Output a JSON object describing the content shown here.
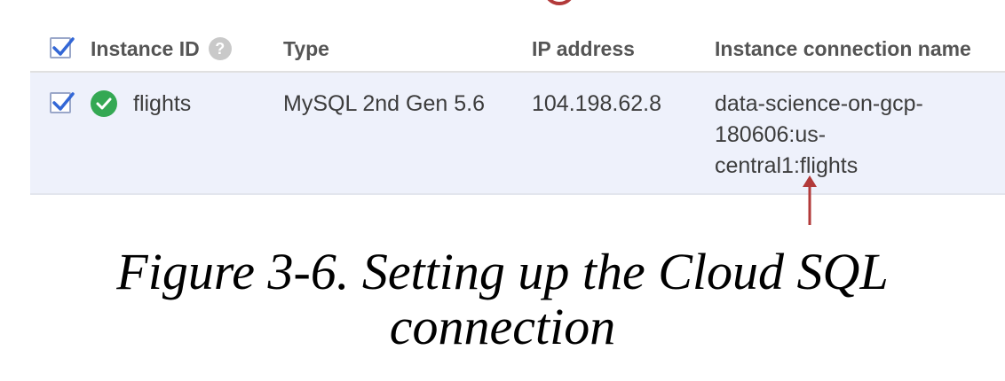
{
  "table": {
    "headers": {
      "instance_id": "Instance ID",
      "type": "Type",
      "ip_address": "IP address",
      "connection_name": "Instance connection name"
    },
    "rows": [
      {
        "selected": true,
        "status": "running",
        "instance_id": "flights",
        "type": "MySQL 2nd Gen 5.6",
        "ip_address": "104.198.62.8",
        "connection_name_lines": [
          "data-science-on-gcp-",
          "180606:us-",
          "central1:flights"
        ]
      }
    ]
  },
  "icons": {
    "header_help": "help-icon",
    "row_status": "check-circle-icon",
    "annotation": "arrow-up-icon"
  },
  "colors": {
    "checkbox_accent": "#3367d6",
    "status_ok": "#34a853",
    "annotation": "#b23a3a",
    "selected_row_bg": "#eef1fb"
  },
  "caption": {
    "line1": "Figure 3-6. Setting up the Cloud SQL",
    "line2": "connection"
  }
}
